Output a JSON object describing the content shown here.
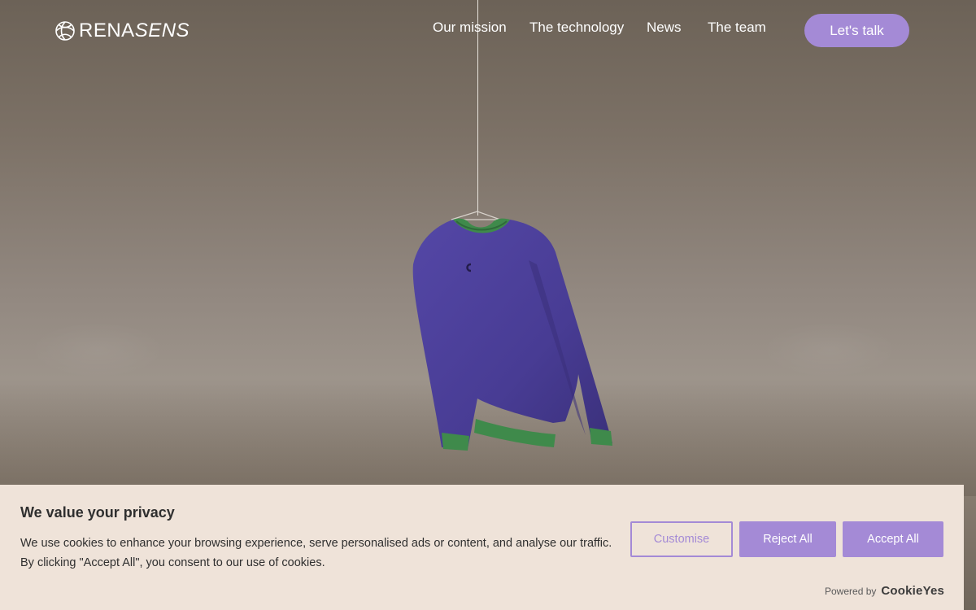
{
  "brand": {
    "name_bold": "RENA",
    "name_light": "SENS",
    "icon": "swirl-logo-icon"
  },
  "nav": {
    "items": [
      {
        "label": "Our mission"
      },
      {
        "label": "The technology"
      },
      {
        "label": "News"
      },
      {
        "label": "The team"
      }
    ],
    "cta_label": "Let's talk"
  },
  "hero": {
    "image": "hanging-sweater-image"
  },
  "cookie_banner": {
    "title": "We value your privacy",
    "text_line1": "We use cookies to enhance your browsing experience, serve personalised ads or content, and analyse our traffic.",
    "text_line2": "By clicking \"Accept All\", you consent to our use of cookies.",
    "customise_label": "Customise",
    "reject_label": "Reject All",
    "accept_label": "Accept All",
    "powered_by_label": "Powered by",
    "powered_by_brand": "CookieYes"
  },
  "colors": {
    "accent": "#a48ad6",
    "banner_bg": "#efe3d9",
    "sweater_body": "#4b3f98",
    "sweater_trim": "#3f8a4b"
  }
}
